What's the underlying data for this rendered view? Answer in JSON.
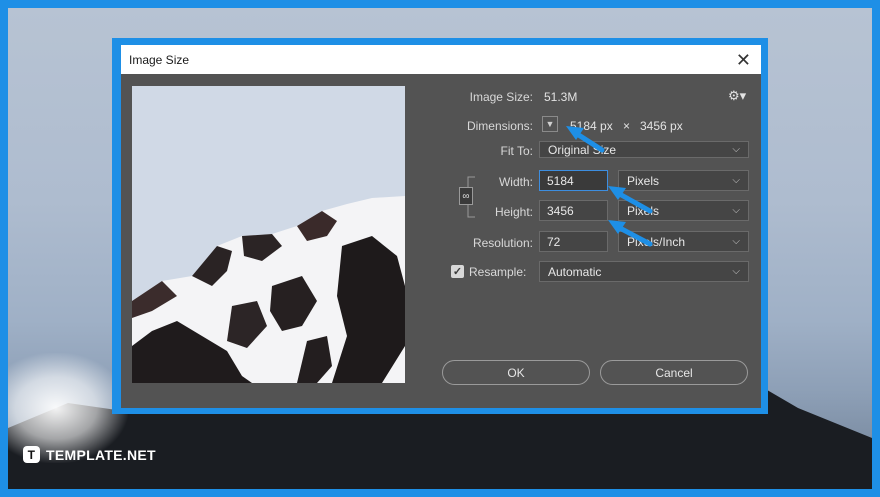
{
  "brand": {
    "text": "TEMPLATE.NET",
    "mark": "T"
  },
  "dialog": {
    "title": "Image Size",
    "image_size": {
      "label": "Image Size:",
      "value": "51.3M"
    },
    "dimensions": {
      "label": "Dimensions:",
      "width": "5184 px",
      "times": "×",
      "height": "3456 px"
    },
    "fit_to": {
      "label": "Fit To:",
      "value": "Original Size"
    },
    "width": {
      "label": "Width:",
      "value": "5184",
      "unit": "Pixels"
    },
    "height": {
      "label": "Height:",
      "value": "3456",
      "unit": "Pixels"
    },
    "resolution": {
      "label": "Resolution:",
      "value": "72",
      "unit": "Pixels/Inch"
    },
    "resample": {
      "label": "Resample:",
      "checked": true,
      "value": "Automatic"
    },
    "ok_label": "OK",
    "cancel_label": "Cancel"
  },
  "colors": {
    "frame": "#1e8fe6",
    "dialog_bg": "#535353",
    "arrow": "#1e8fe6"
  }
}
